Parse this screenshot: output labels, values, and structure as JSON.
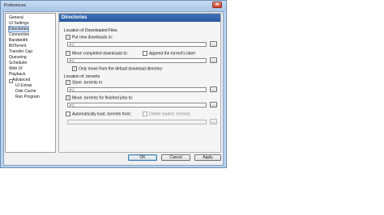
{
  "window": {
    "title": "Preferences",
    "close_glyph": "✕"
  },
  "tree": {
    "items": [
      {
        "label": "General",
        "level": 0,
        "selected": false
      },
      {
        "label": "UI Settings",
        "level": 0,
        "selected": false
      },
      {
        "label": "Directories",
        "level": 0,
        "selected": true
      },
      {
        "label": "Connection",
        "level": 0,
        "selected": false
      },
      {
        "label": "Bandwidth",
        "level": 0,
        "selected": false
      },
      {
        "label": "BitTorrent",
        "level": 0,
        "selected": false
      },
      {
        "label": "Transfer Cap",
        "level": 0,
        "selected": false
      },
      {
        "label": "Queueing",
        "level": 0,
        "selected": false
      },
      {
        "label": "Scheduler",
        "level": 0,
        "selected": false
      },
      {
        "label": "Web UI",
        "level": 0,
        "selected": false
      },
      {
        "label": "Playback",
        "level": 0,
        "selected": false
      },
      {
        "label": "Advanced",
        "level": 0,
        "selected": false,
        "expanded": true
      },
      {
        "label": "UI Extras",
        "level": 1,
        "selected": false
      },
      {
        "label": "Disk Cache",
        "level": 1,
        "selected": false
      },
      {
        "label": "Run Program",
        "level": 1,
        "selected": false
      }
    ],
    "expand_glyph": "−"
  },
  "panel": {
    "title": "Directories",
    "downloaded_section": "Location of Downloaded Files",
    "put_new_downloads": {
      "label": "Put new downloads in:",
      "checked": true
    },
    "put_new_path": "F:\\",
    "move_completed": {
      "label": "Move completed downloads to:",
      "checked": true
    },
    "append_label": {
      "label": "Append the torrent's label",
      "checked": false
    },
    "move_completed_path": "F:\\",
    "only_move_default": {
      "label": "Only move from the default download directory",
      "checked": true
    },
    "torrents_section": "Location of .torrents",
    "store_torrents": {
      "label": "Store .torrents in:",
      "checked": true
    },
    "store_torrents_path": "F:\\",
    "move_torrents": {
      "label": "Move .torrents for finished jobs to:",
      "checked": true
    },
    "move_torrents_path": "F:\\",
    "auto_load": {
      "label": "Automatically load .torrents from:",
      "checked": false
    },
    "delete_loaded": {
      "label": "Delete loaded .torrents",
      "checked": false
    },
    "auto_load_path": "",
    "browse_label": "...",
    "check_glyph": "✓"
  },
  "buttons": {
    "ok": "OK",
    "cancel": "Cancel",
    "apply": "Apply"
  },
  "grip_glyph": "⋰"
}
